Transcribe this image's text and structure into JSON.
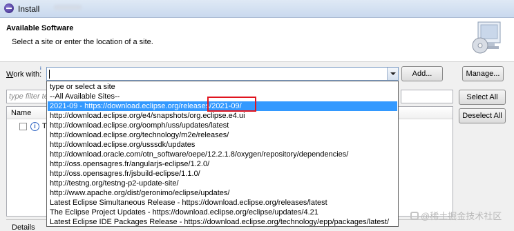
{
  "window": {
    "title": "Install"
  },
  "header": {
    "title": "Available Software",
    "description": "Select a site or enter the location of a site."
  },
  "work_with": {
    "label_prefix": "W",
    "label_rest": "ork with:",
    "value": ""
  },
  "buttons": {
    "add": "Add...",
    "manage": "Manage...",
    "select_all": "Select All",
    "deselect_all": "Deselect All"
  },
  "filter": {
    "placeholder": "type filter te"
  },
  "tree": {
    "column_name": "Name",
    "row_text": "Th"
  },
  "details": {
    "label": "Details"
  },
  "dropdown": {
    "selected_index": 2,
    "items": [
      "type or select a site",
      "--All Available Sites--",
      "2021-09 - https://download.eclipse.org/releases/2021-09/",
      "http://download.eclipse.org/e4/snapshots/org.eclipse.e4.ui",
      "http://download.eclipse.org/oomph/uss/updates/latest",
      "http://download.eclipse.org/technology/m2e/releases/",
      "http://download.eclipse.org/usssdk/updates",
      "http://download.oracle.com/otn_software/oepe/12.2.1.8/oxygen/repository/dependencies/",
      "http://oss.opensagres.fr/angularjs-eclipse/1.2.0/",
      "http://oss.opensagres.fr/jsbuild-eclipse/1.1.0/",
      "http://testng.org/testng-p2-update-site/",
      "http://www.apache.org/dist/geronimo/eclipse/updates/",
      "Latest Eclipse Simultaneous Release - https://download.eclipse.org/releases/latest",
      "The Eclipse Project Updates - https://download.eclipse.org/eclipse/updates/4.21",
      "Latest Eclipse IDE Packages Release - https://download.eclipse.org/technology/epp/packages/latest/"
    ]
  },
  "watermark": {
    "text": "@稀土掘金技术社区"
  },
  "colors": {
    "selection": "#3399ff",
    "highlight_box": "#e0141e"
  }
}
